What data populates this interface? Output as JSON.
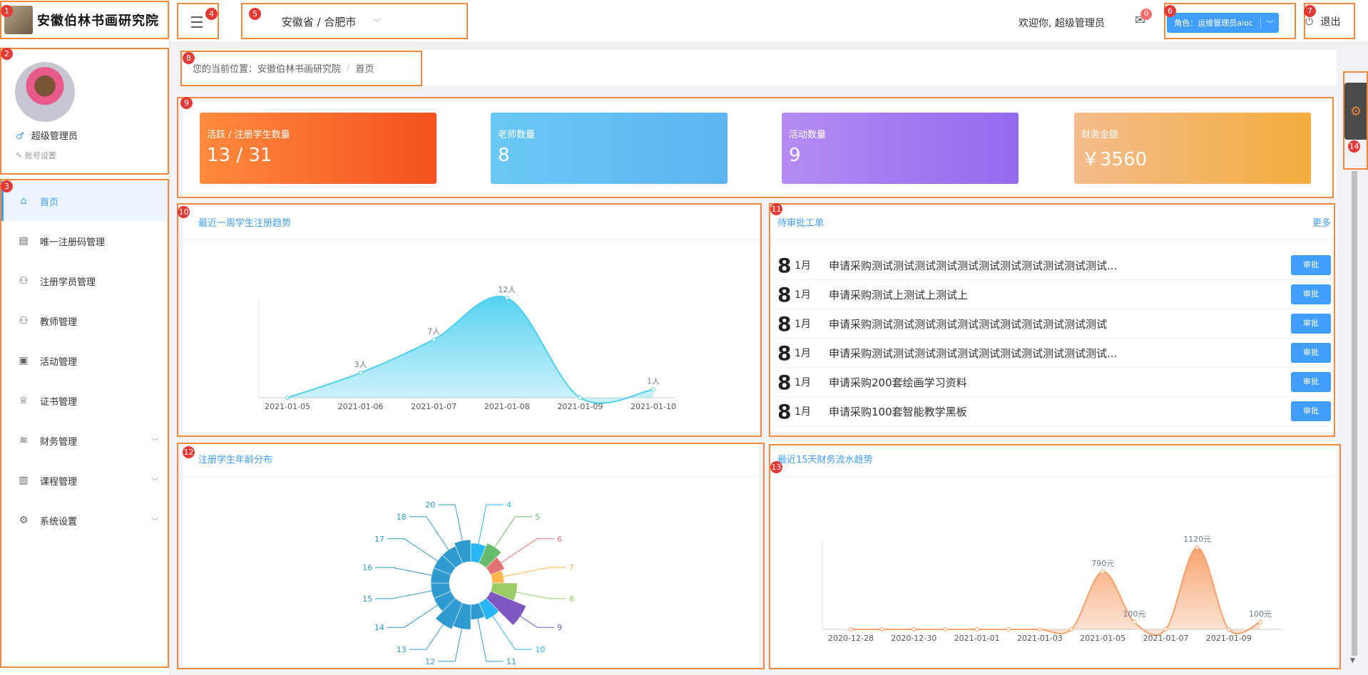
{
  "logo": {
    "text": "安徽伯林书画研究院"
  },
  "profile": {
    "sex_icon": "♂",
    "name": "超级管理员",
    "account_settings": "账号设置"
  },
  "sidebar": {
    "items": [
      {
        "label": "首页",
        "icon": "home-icon",
        "glyph": "⌂",
        "active": true
      },
      {
        "label": "唯一注册码管理",
        "icon": "document-icon",
        "glyph": "▤"
      },
      {
        "label": "注册学员管理",
        "icon": "user-icon",
        "glyph": "⚇"
      },
      {
        "label": "教师管理",
        "icon": "user-icon",
        "glyph": "⚇"
      },
      {
        "label": "活动管理",
        "icon": "gift-icon",
        "glyph": "▣"
      },
      {
        "label": "证书管理",
        "icon": "trophy-icon",
        "glyph": "♕"
      },
      {
        "label": "财务管理",
        "icon": "coins-icon",
        "glyph": "≋",
        "expandable": true
      },
      {
        "label": "课程管理",
        "icon": "book-icon",
        "glyph": "▥",
        "expandable": true
      },
      {
        "label": "系统设置",
        "icon": "gear-icon",
        "glyph": "⚙",
        "expandable": true
      }
    ]
  },
  "header": {
    "region": "安徽省 / 合肥市",
    "welcome": "欢迎你, 超级管理员",
    "message_count": "0",
    "role_button": "角色：运维管理员aioc",
    "logout": "退出"
  },
  "breadcrumb": {
    "prefix": "您的当前位置：",
    "home": "安徽伯林书画研究院",
    "separator": "/",
    "current": "首页"
  },
  "stats": [
    {
      "label": "活跃 / 注册学生数量",
      "value": "13 / 31",
      "gradient": [
        "#ff8a3d",
        "#f4511e"
      ]
    },
    {
      "label": "老师数量",
      "value": "8",
      "gradient": [
        "#6ac8f4",
        "#5db5f1"
      ]
    },
    {
      "label": "活动数量",
      "value": "9",
      "gradient": [
        "#b58bf3",
        "#9569ee"
      ]
    },
    {
      "label": "财务金额",
      "value": "￥3560",
      "gradient": [
        "#f3bc8c",
        "#f3ad3d"
      ]
    }
  ],
  "panels": {
    "trend_title": "最近一周学生注册趋势",
    "orders_title": "待审批工单",
    "orders_more": "更多",
    "age_title": "注册学生年龄分布",
    "finance_title": "最近15天财务流水趋势"
  },
  "orders": [
    {
      "day": "8",
      "month": "1月",
      "text": "申请采购测试测试测试测试测试测试测试测试测试测试测试...",
      "button": "审批"
    },
    {
      "day": "8",
      "month": "1月",
      "text": "申请采购测试上测试上测试上",
      "button": "审批"
    },
    {
      "day": "8",
      "month": "1月",
      "text": "申请采购测试测试测试测试测试测试测试测试测试测试测试",
      "button": "审批"
    },
    {
      "day": "8",
      "month": "1月",
      "text": "申请采购测试测试测试测试测试测试测试测试测试测试测试...",
      "button": "审批"
    },
    {
      "day": "8",
      "month": "1月",
      "text": "申请采购200套绘画学习资料",
      "button": "审批"
    },
    {
      "day": "8",
      "month": "1月",
      "text": "申请采购100套智能教学黑板",
      "button": "审批"
    }
  ],
  "chart_data": [
    {
      "type": "area",
      "categories": [
        "2021-01-05",
        "2021-01-06",
        "2021-01-07",
        "2021-01-08",
        "2021-01-09",
        "2021-01-10"
      ],
      "values": [
        0,
        3,
        7,
        12,
        0,
        1
      ],
      "labels": [
        "",
        "3人",
        "7人",
        "12人",
        "",
        "1人"
      ],
      "ylim": [
        0,
        12
      ],
      "color": "#4dd0f0"
    },
    {
      "type": "pie",
      "variant": "nightingale-rose",
      "categories": [
        "4",
        "5",
        "6",
        "7",
        "8",
        "9",
        "10",
        "11",
        "12",
        "13",
        "14",
        "15",
        "16",
        "17",
        "18",
        "20"
      ],
      "values": [
        3,
        4,
        2,
        1,
        5,
        9,
        3,
        2,
        5,
        6,
        3,
        3,
        3,
        3,
        3,
        4
      ],
      "colors": [
        "#29b6f6",
        "#66bb6a",
        "#e57373",
        "#ffb74d",
        "#9ccc65",
        "#7e57c2",
        "#29b6f6",
        "#2e9ad0",
        "#2e9ad0",
        "#2e9ad0",
        "#2e9ad0",
        "#2e9ad0",
        "#2e9ad0",
        "#2e9ad0",
        "#2e9ad0",
        "#2e9ad0"
      ]
    },
    {
      "type": "area",
      "categories": [
        "2020-12-28",
        "2020-12-29",
        "2020-12-30",
        "2020-12-31",
        "2021-01-01",
        "2021-01-02",
        "2021-01-03",
        "2021-01-04",
        "2021-01-05",
        "2021-01-06",
        "2021-01-07",
        "2021-01-08",
        "2021-01-09",
        "2021-01-10"
      ],
      "tick_labels": [
        "2020-12-28",
        "2020-12-30",
        "2021-01-01",
        "2021-01-03",
        "2021-01-05",
        "2021-01-07",
        "2021-01-09"
      ],
      "values": [
        0,
        0,
        0,
        0,
        0,
        0,
        0,
        0,
        790,
        100,
        0,
        1120,
        0,
        100
      ],
      "labels": [
        "",
        "",
        "",
        "",
        "",
        "",
        "",
        "",
        "790元",
        "100元",
        "",
        "1120元",
        "",
        "100元"
      ],
      "ylim": [
        0,
        1200
      ],
      "color": "#f8a06a"
    }
  ]
}
